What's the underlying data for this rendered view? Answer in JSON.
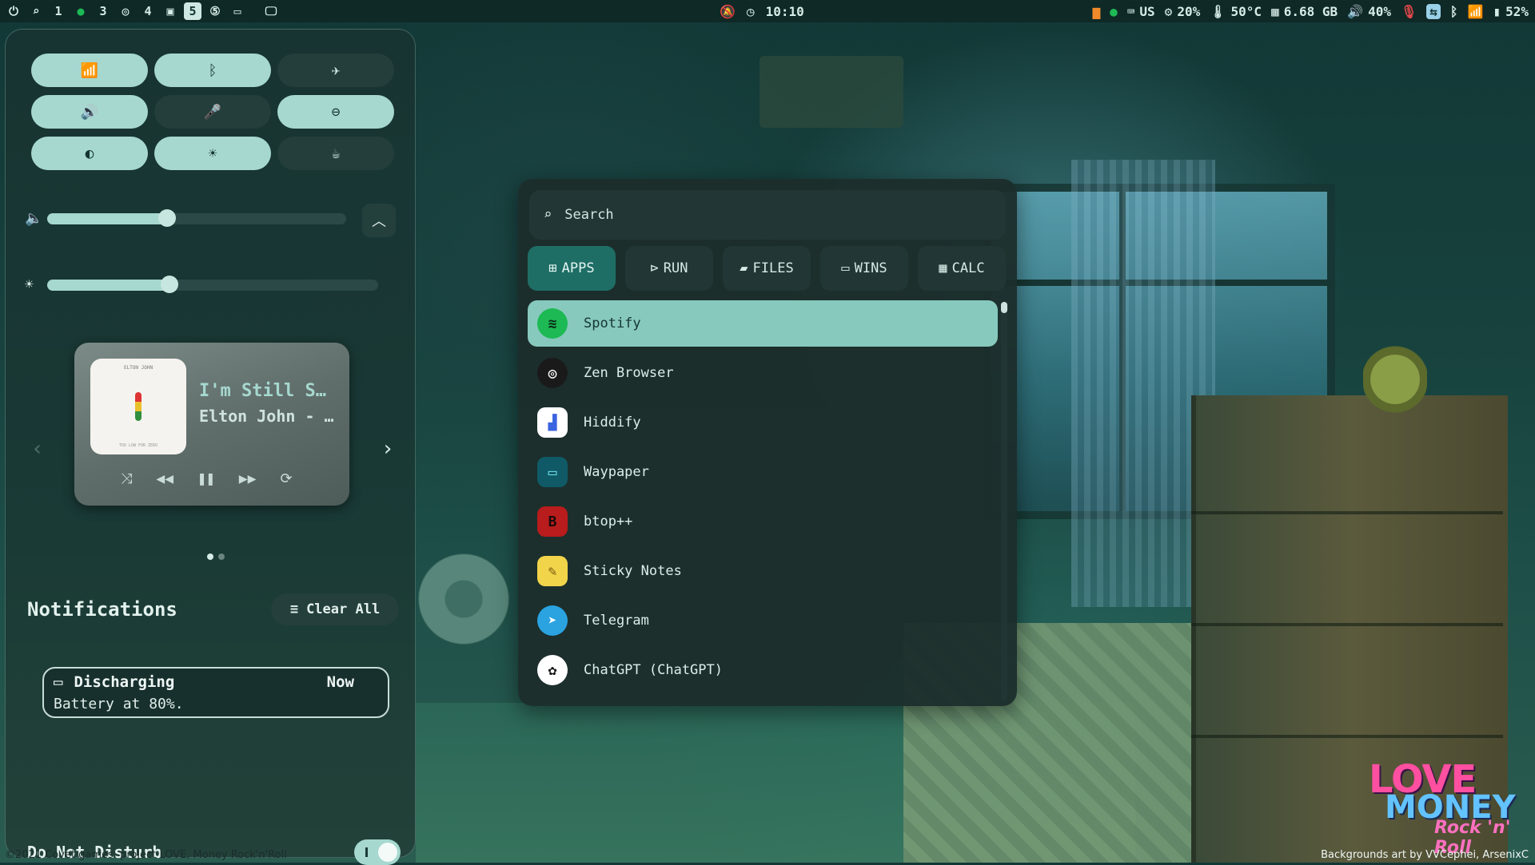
{
  "topbar": {
    "workspaces": [
      "1",
      "3",
      "4",
      "5"
    ],
    "active_workspace": "5",
    "clock": "10:10",
    "keyboard_layout": "US",
    "cpu": "20%",
    "temp": "50°C",
    "memory": "6.68 GB",
    "volume": "40%",
    "battery": "52%"
  },
  "quick_settings": [
    {
      "name": "wifi",
      "icon": "wifi-icon",
      "glyph": "📶",
      "on": true
    },
    {
      "name": "bluetooth",
      "icon": "bluetooth-icon",
      "glyph": "ᛒ",
      "on": true
    },
    {
      "name": "airplane",
      "icon": "airplane-icon",
      "glyph": "✈",
      "on": false
    },
    {
      "name": "speaker",
      "icon": "speaker-icon",
      "glyph": "🔊",
      "on": true
    },
    {
      "name": "microphone",
      "icon": "microphone-icon",
      "glyph": "🎤",
      "on": false
    },
    {
      "name": "do-not-disturb",
      "icon": "minus-circle-icon",
      "glyph": "⊖",
      "on": true
    },
    {
      "name": "night-light",
      "icon": "contrast-icon",
      "glyph": "◐",
      "on": true
    },
    {
      "name": "brightness",
      "icon": "sun-icon",
      "glyph": "☀",
      "on": true
    },
    {
      "name": "caffeine",
      "icon": "coffee-icon",
      "glyph": "☕",
      "on": false
    }
  ],
  "sliders": {
    "volume_level": 0.4,
    "brightness_level": 0.37
  },
  "media": {
    "album_caption": "ELTON JOHN",
    "album_caption_bottom": "TOO LOW FOR ZERO",
    "title": "I'm Still S…",
    "artist": "Elton John - …",
    "page_count": 2,
    "active_page": 0
  },
  "notifications": {
    "heading": "Notifications",
    "clear_label": "Clear All",
    "items": [
      {
        "title": "Discharging",
        "time": "Now",
        "body": "Battery at 80%."
      }
    ]
  },
  "dnd": {
    "label": "Do Not Disturb",
    "on": true
  },
  "launcher": {
    "search_placeholder": "Search",
    "tabs": [
      {
        "label": "APPS",
        "icon": "grid-icon",
        "glyph": "⊞",
        "active": true
      },
      {
        "label": "RUN",
        "icon": "terminal-icon",
        "glyph": "⊳",
        "active": false
      },
      {
        "label": "FILES",
        "icon": "folder-icon",
        "glyph": "▰",
        "active": false
      },
      {
        "label": "WINS",
        "icon": "window-icon",
        "glyph": "▭",
        "active": false
      },
      {
        "label": "CALC",
        "icon": "calculator-icon",
        "glyph": "▦",
        "active": false
      }
    ],
    "apps": [
      {
        "name": "Spotify",
        "icon": "spotify-icon",
        "color": "#1db954",
        "fg": "#0b2a18",
        "glyph": "≋",
        "selected": true
      },
      {
        "name": "Zen Browser",
        "icon": "zen-browser-icon",
        "color": "#1a1a1a",
        "fg": "#ffffff",
        "glyph": "◎",
        "selected": false
      },
      {
        "name": "Hiddify",
        "icon": "hiddify-icon",
        "color": "#ffffff",
        "fg": "#3a63e0",
        "glyph": "▟",
        "selected": false
      },
      {
        "name": "Waypaper",
        "icon": "waypaper-icon",
        "color": "#0f5a66",
        "fg": "#6ee0f0",
        "glyph": "▭",
        "selected": false
      },
      {
        "name": "btop++",
        "icon": "btop-icon",
        "color": "#b81c1c",
        "fg": "#1a0a0a",
        "glyph": "B",
        "selected": false
      },
      {
        "name": "Sticky Notes",
        "icon": "sticky-notes-icon",
        "color": "#f2d44a",
        "fg": "#7a5a10",
        "glyph": "✎",
        "selected": false
      },
      {
        "name": "Telegram",
        "icon": "telegram-icon",
        "color": "#2aa3e0",
        "fg": "#ffffff",
        "glyph": "➤",
        "selected": false
      },
      {
        "name": "ChatGPT (ChatGPT)",
        "icon": "chatgpt-icon",
        "color": "#ffffff",
        "fg": "#111111",
        "glyph": "✿",
        "selected": false
      }
    ]
  },
  "footer": {
    "left": "©2021 Covet games. project LOVE, Money Rock'n'Roll",
    "right": "Backgrounds art by VVCephei, ArsenixC"
  },
  "wallpaper_logo": {
    "line1": "LOVE",
    "line2": "MONEY",
    "line3": "Rock 'n' Roll"
  },
  "colors": {
    "accent": "#a6d8cf",
    "selected_app": "#87c9bd",
    "active_tab": "#1e6e66"
  }
}
